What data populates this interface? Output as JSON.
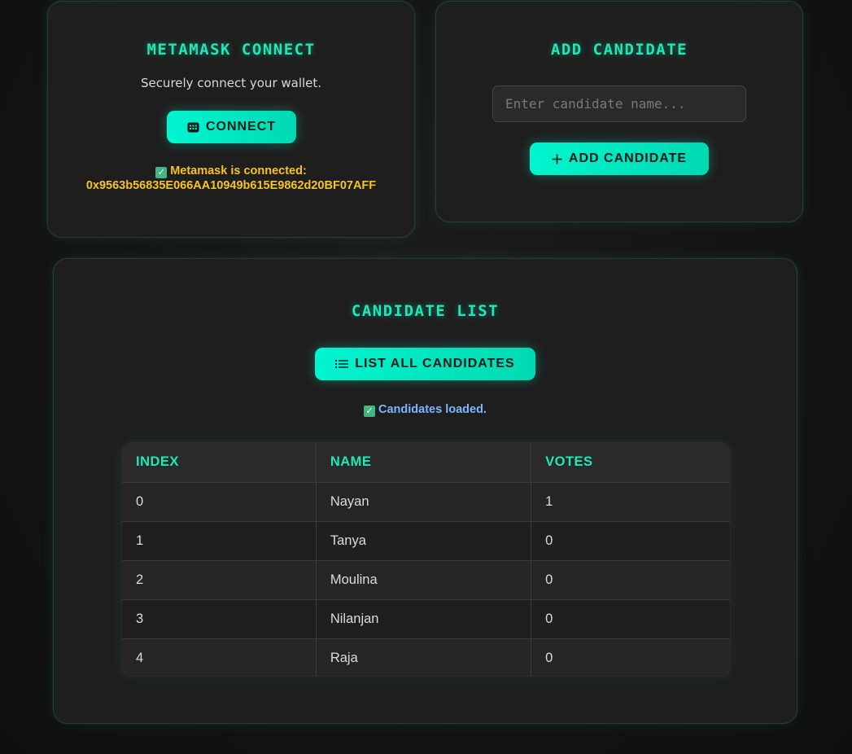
{
  "connect_card": {
    "title": "METAMASK CONNECT",
    "subtitle": "Securely connect your wallet.",
    "button_label": "CONNECT",
    "status_text": "Metamask is connected:",
    "address": "0x9563b56835E066AA10949b615E9862d20BF07AFF",
    "status_color": "#f9c31f"
  },
  "add_card": {
    "title": "ADD CANDIDATE",
    "input_placeholder": "Enter candidate name...",
    "input_value": "",
    "button_label": "ADD CANDIDATE"
  },
  "list_card": {
    "title": "CANDIDATE LIST",
    "button_label": "LIST ALL CANDIDATES",
    "status_text": "Candidates loaded.",
    "status_color": "#7ab8ff",
    "table": {
      "headers": [
        "INDEX",
        "NAME",
        "VOTES"
      ],
      "rows": [
        [
          "0",
          "Nayan",
          "1"
        ],
        [
          "1",
          "Tanya",
          "0"
        ],
        [
          "2",
          "Moulina",
          "0"
        ],
        [
          "3",
          "Nilanjan",
          "0"
        ],
        [
          "4",
          "Raja",
          "0"
        ]
      ]
    }
  },
  "colors": {
    "accent": "#1de9b6",
    "button_gradient_start": "#00f5d0",
    "button_gradient_end": "#00d9b2",
    "card_bg": "#1e1e1e",
    "page_bg": "#121212"
  },
  "icons": {
    "connect_button": "wallet-icon",
    "add_button": "plus-icon",
    "list_button": "list-icon",
    "status_check": "check-box-icon"
  }
}
